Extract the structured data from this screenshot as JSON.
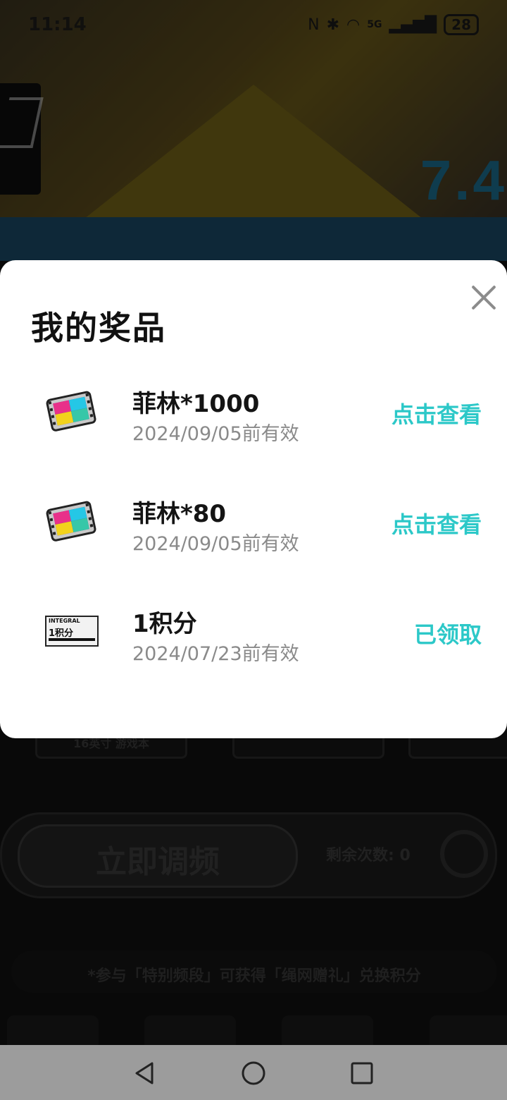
{
  "status_bar": {
    "time": "11:14",
    "network": "5G",
    "battery": "28"
  },
  "background": {
    "hero_badge": "7.4",
    "bottom_tab_labels": [
      "16英寸 游戏本",
      "",
      ""
    ],
    "tune_button_label": "立即调频",
    "remaining_label": "剩余次数: 0",
    "note": "*参与「特别频段」可获得「绳网赠礼」兑换积分"
  },
  "modal": {
    "title": "我的奖品",
    "close_icon": "close-icon",
    "prizes": [
      {
        "name": "菲林*1000",
        "valid_until": "2024/09/05前有效",
        "action": "点击查看",
        "icon": "film-icon"
      },
      {
        "name": "菲林*80",
        "valid_until": "2024/09/05前有效",
        "action": "点击查看",
        "icon": "film-icon"
      },
      {
        "name": "1积分",
        "valid_until": "2024/07/23前有效",
        "action": "已领取",
        "icon": "integral-ticket-icon",
        "ticket_label": "INTEGRAL",
        "ticket_value": "1积分"
      }
    ],
    "accent_color": "#2cc8c8"
  },
  "nav_bar": {
    "back": "back-icon",
    "home": "home-icon",
    "recents": "recents-icon"
  }
}
